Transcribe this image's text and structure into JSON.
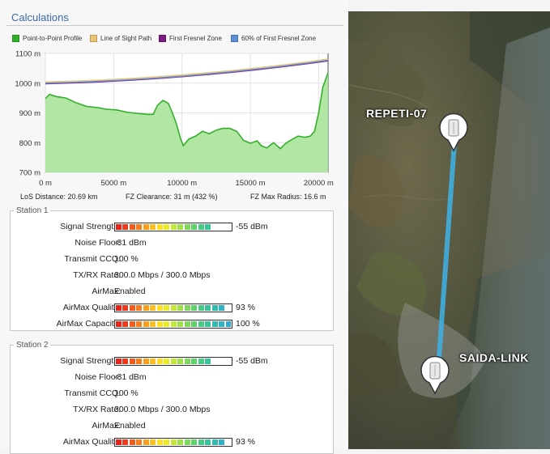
{
  "panel": {
    "title": "Calculations"
  },
  "legend": [
    {
      "label": "Point-to-Point Profile",
      "color": "#33b02a"
    },
    {
      "label": "Line of Sight Path",
      "color": "#e8c470"
    },
    {
      "label": "First Fresnel Zone",
      "color": "#7a1c82"
    },
    {
      "label": "60% of First Fresnel Zone",
      "color": "#5c8fd6"
    }
  ],
  "chart_data": {
    "type": "area",
    "x_ticks": [
      "0 m",
      "5000 m",
      "10000 m",
      "15000 m",
      "20000 m"
    ],
    "y_ticks": [
      "700 m",
      "800 m",
      "900 m",
      "1000 m",
      "1100 m"
    ],
    "xlim": [
      0,
      20690
    ],
    "ylim": [
      700,
      1100
    ],
    "series": [
      {
        "name": "Point-to-Point Profile",
        "x": [
          0,
          300,
          800,
          1500,
          2200,
          3000,
          3800,
          4500,
          5200,
          6000,
          6800,
          7500,
          7900,
          8200,
          8600,
          9000,
          9300,
          9600,
          9900,
          10100,
          10500,
          11000,
          11500,
          12000,
          12500,
          13000,
          13500,
          14000,
          14500,
          15000,
          15500,
          15800,
          16200,
          16700,
          17200,
          17600,
          18100,
          18500,
          19000,
          19400,
          19700,
          20000,
          20300,
          20690
        ],
        "y": [
          948,
          962,
          955,
          950,
          935,
          922,
          918,
          912,
          910,
          902,
          898,
          895,
          895,
          925,
          942,
          932,
          900,
          862,
          812,
          790,
          812,
          822,
          838,
          830,
          842,
          848,
          848,
          838,
          808,
          798,
          806,
          790,
          782,
          800,
          780,
          798,
          812,
          822,
          818,
          822,
          838,
          900,
          985,
          1035
        ]
      },
      {
        "name": "Line of Sight Path",
        "x": [
          0,
          20690
        ],
        "y": [
          1003,
          1080
        ]
      },
      {
        "name": "First Fresnel Zone",
        "x": [
          0,
          20690
        ],
        "y": [
          998,
          1075
        ]
      },
      {
        "name": "60% of First Fresnel Zone",
        "x": [
          0,
          20690
        ],
        "y": [
          1000,
          1077
        ]
      }
    ]
  },
  "stats": {
    "los_distance": "LoS Distance: 20.69 km",
    "fz_clearance": "FZ Clearance: 31 m  (432 %)",
    "fz_max_radius": "FZ Max Radius: 16.6 m"
  },
  "station1": {
    "title": "Station 1",
    "rows": [
      {
        "label": "Signal Strength:",
        "type": "meter",
        "value": "-55 dBm",
        "level": 0.8
      },
      {
        "label": "Noise Floor:",
        "type": "text",
        "value": "-81 dBm"
      },
      {
        "label": "Transmit CCQ:",
        "type": "text",
        "value": "100 %"
      },
      {
        "label": "TX/RX Rate:",
        "type": "text",
        "value": "300.0 Mbps / 300.0 Mbps"
      },
      {
        "label": "AirMax:",
        "type": "text",
        "value": "Enabled"
      },
      {
        "label": "AirMax Quality:",
        "type": "meter",
        "value": "93 %",
        "level": 0.93
      },
      {
        "label": "AirMax Capacity:",
        "type": "meter",
        "value": "100 %",
        "level": 1.0
      }
    ]
  },
  "station2": {
    "title": "Station 2",
    "rows": [
      {
        "label": "Signal Strength:",
        "type": "meter",
        "value": "-55 dBm",
        "level": 0.8
      },
      {
        "label": "Noise Floor:",
        "type": "text",
        "value": "-81 dBm"
      },
      {
        "label": "Transmit CCQ:",
        "type": "text",
        "value": "100 %"
      },
      {
        "label": "TX/RX Rate:",
        "type": "text",
        "value": "300.0 Mbps / 300.0 Mbps"
      },
      {
        "label": "AirMax:",
        "type": "text",
        "value": "Enabled"
      },
      {
        "label": "AirMax Quality:",
        "type": "meter",
        "value": "93 %",
        "level": 0.93
      }
    ]
  },
  "map": {
    "site_a": "REPETI-07",
    "site_b": "SAIDA-LINK",
    "link_color": "#3fb3e8"
  }
}
